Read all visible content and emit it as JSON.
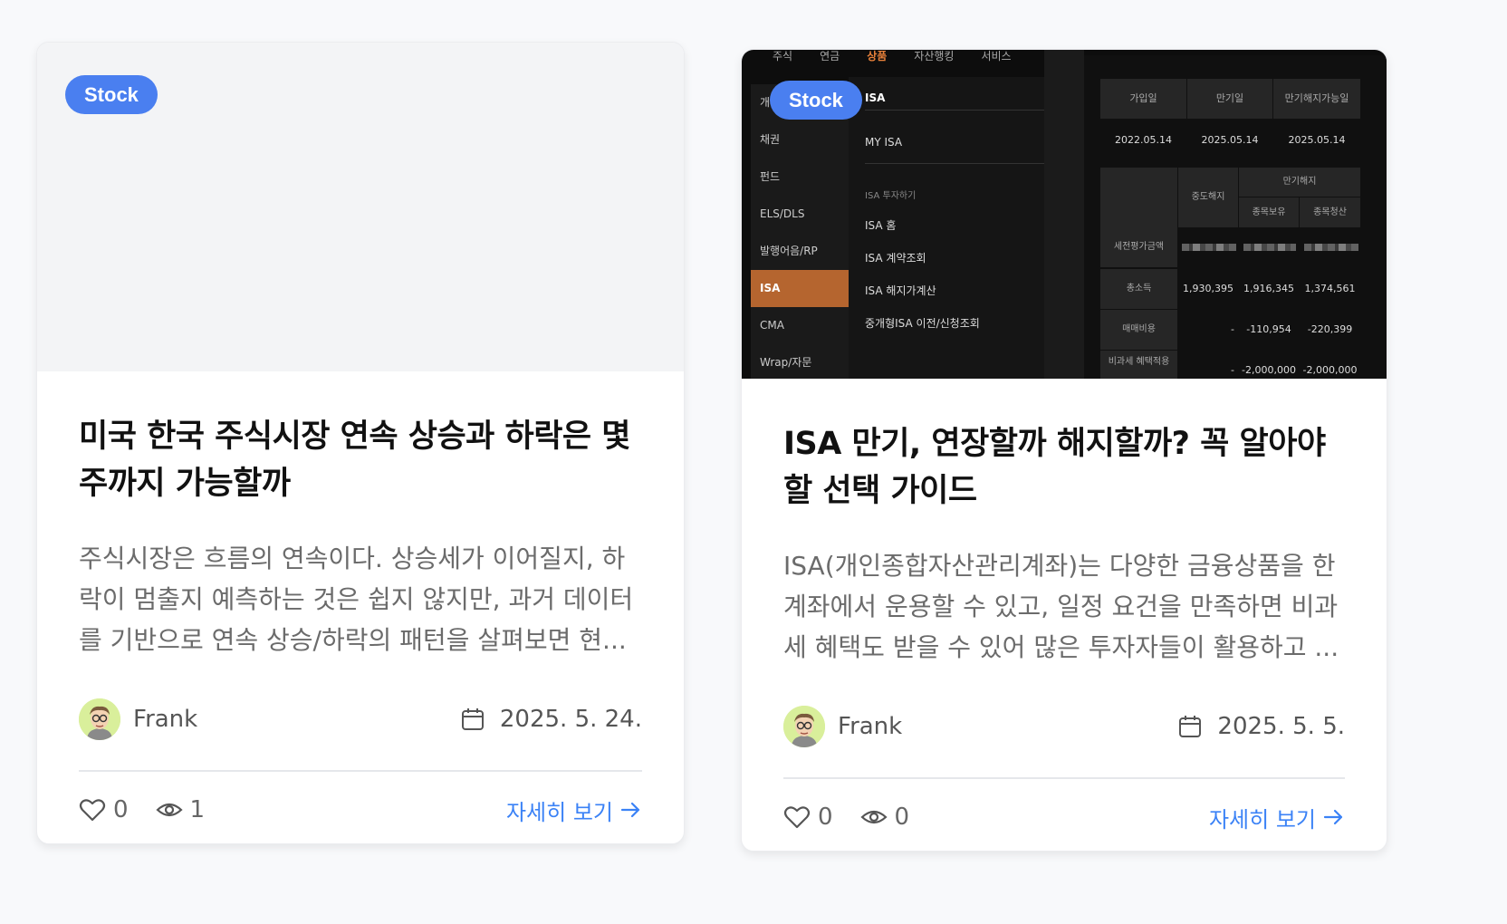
{
  "cards": [
    {
      "badge": "Stock",
      "title": "미국 한국 주식시장 연속 상승과 하락은 몇 주까지 가능할까",
      "excerpt": "주식시장은 흐름의 연속이다. 상승세가 이어질지, 하락이 멈출지 예측하는 것은 쉽지 않지만, 과거 데이터를 기반으로 연속 상승/하락의 패턴을 살펴보면 현...",
      "author": "Frank",
      "date": "2025. 5. 24.",
      "likes": "0",
      "views": "1",
      "more": "자세히 보기"
    },
    {
      "badge": "Stock",
      "title": "ISA 만기, 연장할까 해지할까? 꼭 알아야 할 선택 가이드",
      "excerpt": "ISA(개인종합자산관리계좌)는 다양한 금융상품을 한 계좌에서 운용할 수 있고, 일정 요건을 만족하면 비과세 혜택도 받을 수 있어 많은 투자자들이 활용하고 ...",
      "author": "Frank",
      "date": "2025. 5. 5.",
      "likes": "0",
      "views": "0",
      "more": "자세히 보기",
      "thumbnail": {
        "topnav": [
          "주식",
          "연금",
          "상품",
          "자산행킹",
          "서비스"
        ],
        "leftnav": [
          "개",
          "채권",
          "펀드",
          "ELS/DLS",
          "발행어음/RP",
          "ISA",
          "CMA",
          "Wrap/자문"
        ],
        "midnav": {
          "header": "ISA",
          "item1": "MY ISA",
          "section": "ISA 투자하기",
          "items": [
            "ISA 홈",
            "ISA 계약조회",
            "ISA 해지가계산",
            "중개형ISA 이전/신청조회"
          ]
        },
        "table": {
          "head": [
            "가입일",
            "만기일",
            "만기해지가능일"
          ],
          "dates": [
            "2022.05.14",
            "2025.05.14",
            "2025.05.14"
          ],
          "sub_head": [
            "중도해지",
            "만기해지",
            "종목보유",
            "종목청산"
          ],
          "row_labels": [
            "세전평가금액",
            "총소득",
            "매매비용",
            "비과세 혜택적용"
          ],
          "income": [
            "1,930,395",
            "1,916,345",
            "1,374,561"
          ],
          "cost": [
            "-",
            "-110,954",
            "-220,399"
          ],
          "taxfree": [
            "-",
            "-2,000,000",
            "-2,000,000"
          ]
        }
      }
    }
  ],
  "colors": {
    "accent": "#4a7ff0",
    "link": "#3b82f6",
    "isa_active": "#b5652f"
  }
}
